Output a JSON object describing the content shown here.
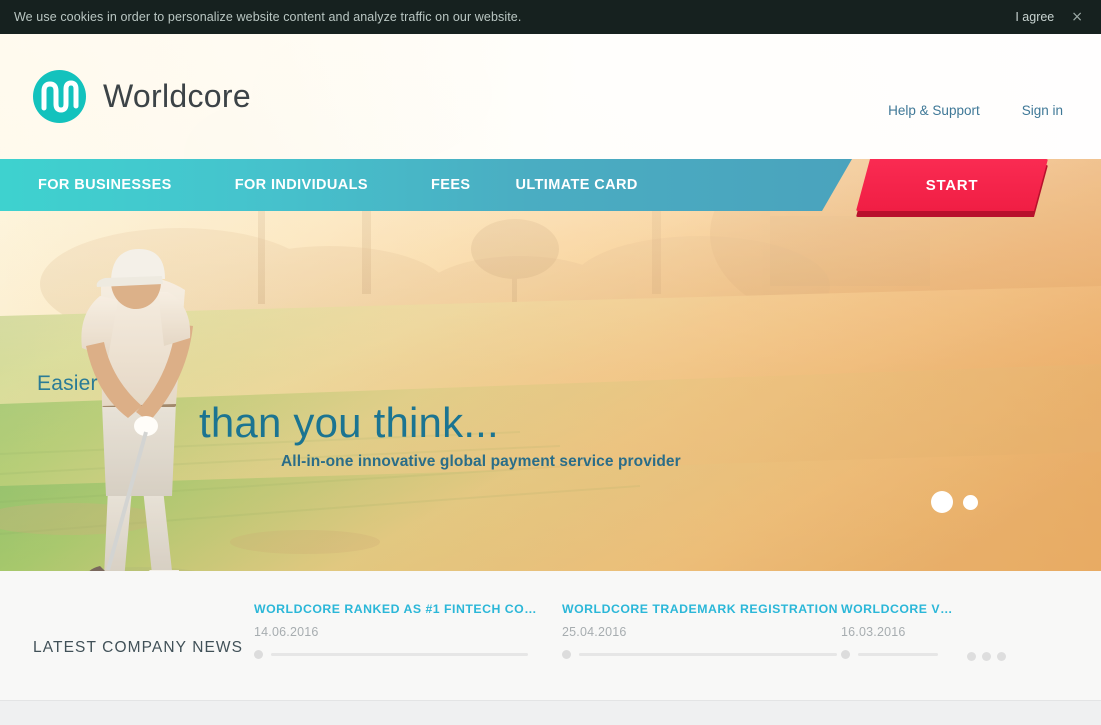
{
  "cookie": {
    "message": "We use cookies in order to personalize website content and analyze traffic on our website.",
    "agree_label": "I agree",
    "close_icon": "×"
  },
  "header": {
    "brand": "Worldcore",
    "logo_icon": "worldcore-wave-logo",
    "links": [
      {
        "label": "Help & Support"
      },
      {
        "label": "Sign in"
      }
    ]
  },
  "nav": {
    "items": [
      {
        "label": "FOR BUSINESSES"
      },
      {
        "label": "FOR INDIVIDUALS"
      },
      {
        "label": "FEES"
      },
      {
        "label": "ULTIMATE CARD"
      }
    ],
    "cta": {
      "label": "START",
      "color": "#f5234a"
    }
  },
  "hero": {
    "headline_small": "Easier",
    "headline_large": "than you think...",
    "subtitle": "All-in-one innovative global payment service provider",
    "slides": [
      {
        "active": true
      },
      {
        "active": false
      }
    ],
    "image_alt": "golfer-teeing-off-at-sunrise"
  },
  "news": {
    "section_title": "LATEST COMPANY NEWS",
    "items": [
      {
        "headline": "WORLDCORE RANKED AS #1 FINTECH COMP…",
        "date": "14.06.2016"
      },
      {
        "headline": "WORLDCORE TRADEMARK REGISTRATION",
        "date": "25.04.2016"
      },
      {
        "headline": "WORLDCORE V…",
        "date": "16.03.2016"
      }
    ],
    "more_icon": "ellipsis-icon"
  },
  "colors": {
    "teal": "#3ed2cf",
    "steel_blue": "#4aa3bd",
    "accent_red": "#f5234a",
    "news_link": "#2bb7d8",
    "hero_text": "#1b7491",
    "cookie_bg": "#16211f"
  }
}
